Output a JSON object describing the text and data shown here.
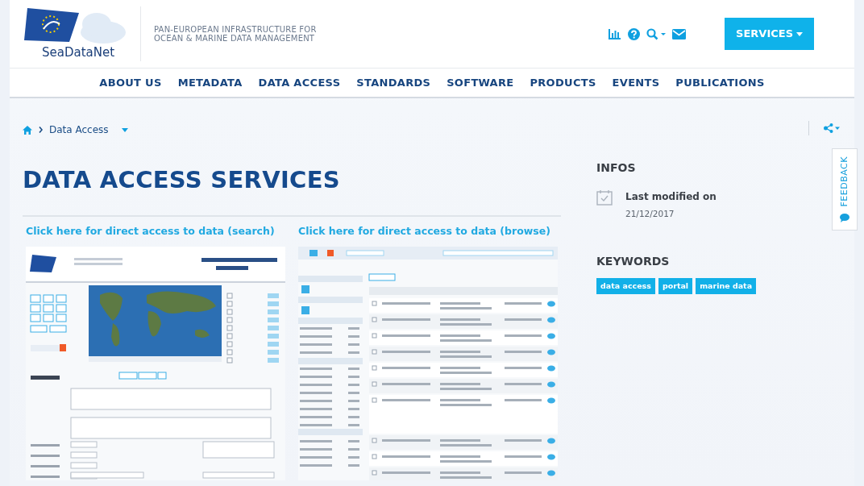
{
  "header": {
    "logo_text": "SeaDataNet",
    "tagline": [
      "PAN-EUROPEAN INFRASTRUCTURE FOR",
      "OCEAN & MARINE DATA MANAGEMENT"
    ],
    "services_button": "SERVICES"
  },
  "nav": [
    "ABOUT US",
    "METADATA",
    "DATA ACCESS",
    "STANDARDS",
    "SOFTWARE",
    "PRODUCTS",
    "EVENTS",
    "PUBLICATIONS"
  ],
  "breadcrumb": [
    {
      "label": "Data Access"
    }
  ],
  "title": "DATA ACCESS SERVICES",
  "services": [
    {
      "link": "Click here for direct access to data (search)",
      "kind": "search"
    },
    {
      "link": "Click here for direct access to data (browse)",
      "kind": "browse"
    }
  ],
  "infos": {
    "heading": "INFOS",
    "label": "Last modified on",
    "date": "21/12/2017"
  },
  "keywords": {
    "heading": "KEYWORDS",
    "tags": [
      "data access",
      "portal",
      "marine data"
    ]
  },
  "feedback": "FEEDBACK"
}
